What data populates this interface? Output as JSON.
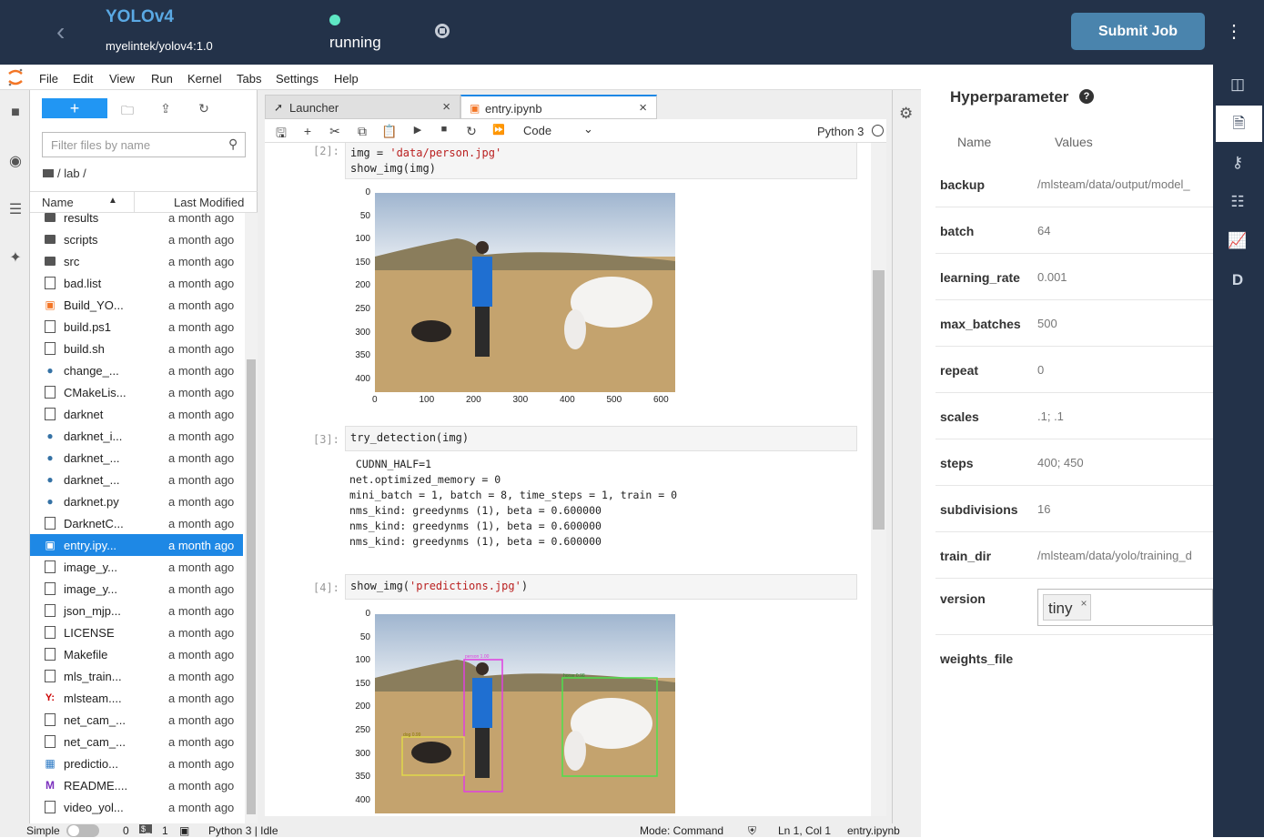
{
  "header": {
    "title": "YOLOv4",
    "image": "myelintek/yolov4:1.0",
    "status": "running",
    "submit_label": "Submit Job"
  },
  "menu": [
    "File",
    "Edit",
    "View",
    "Run",
    "Kernel",
    "Tabs",
    "Settings",
    "Help"
  ],
  "filebrowser": {
    "new_label": "+",
    "filter_placeholder": "Filter files by name",
    "breadcrumb": "/ lab /",
    "col_name": "Name",
    "col_modified": "Last Modified",
    "files": [
      {
        "name": "results",
        "type": "folder",
        "modified": "a month ago"
      },
      {
        "name": "scripts",
        "type": "folder",
        "modified": "a month ago"
      },
      {
        "name": "src",
        "type": "folder",
        "modified": "a month ago"
      },
      {
        "name": "bad.list",
        "type": "file",
        "modified": "a month ago"
      },
      {
        "name": "Build_YO...",
        "type": "notebook",
        "modified": "a month ago"
      },
      {
        "name": "build.ps1",
        "type": "file",
        "modified": "a month ago"
      },
      {
        "name": "build.sh",
        "type": "file",
        "modified": "a month ago"
      },
      {
        "name": "change_...",
        "type": "python",
        "modified": "a month ago"
      },
      {
        "name": "CMakeLis...",
        "type": "file",
        "modified": "a month ago"
      },
      {
        "name": "darknet",
        "type": "file",
        "modified": "a month ago"
      },
      {
        "name": "darknet_i...",
        "type": "python",
        "modified": "a month ago"
      },
      {
        "name": "darknet_...",
        "type": "python",
        "modified": "a month ago"
      },
      {
        "name": "darknet_...",
        "type": "python",
        "modified": "a month ago"
      },
      {
        "name": "darknet.py",
        "type": "python",
        "modified": "a month ago"
      },
      {
        "name": "DarknetC...",
        "type": "file",
        "modified": "a month ago"
      },
      {
        "name": "entry.ipy...",
        "type": "notebook",
        "modified": "a month ago",
        "selected": true
      },
      {
        "name": "image_y...",
        "type": "file",
        "modified": "a month ago"
      },
      {
        "name": "image_y...",
        "type": "file",
        "modified": "a month ago"
      },
      {
        "name": "json_mjp...",
        "type": "file",
        "modified": "a month ago"
      },
      {
        "name": "LICENSE",
        "type": "file",
        "modified": "a month ago"
      },
      {
        "name": "Makefile",
        "type": "file",
        "modified": "a month ago"
      },
      {
        "name": "mls_train...",
        "type": "file",
        "modified": "a month ago"
      },
      {
        "name": "mlsteam....",
        "type": "yaml",
        "modified": "a month ago"
      },
      {
        "name": "net_cam_...",
        "type": "file",
        "modified": "a month ago"
      },
      {
        "name": "net_cam_...",
        "type": "file",
        "modified": "a month ago"
      },
      {
        "name": "predictio...",
        "type": "image",
        "modified": "a month ago"
      },
      {
        "name": "README....",
        "type": "markdown",
        "modified": "a month ago"
      },
      {
        "name": "video_yol...",
        "type": "file",
        "modified": "a month ago"
      }
    ]
  },
  "tabs": [
    {
      "label": "Launcher"
    },
    {
      "label": "entry.ipynb"
    }
  ],
  "notebook": {
    "cell_type": "Code",
    "kernel": "Python 3",
    "cells": [
      {
        "prompt": "[2]:",
        "code_line1_a": "img = ",
        "code_line1_str": "'data/person.jpg'",
        "code_line2": "show_img(img)"
      },
      {
        "prompt": "[3]:",
        "code": "try_detection(img)",
        "output": " CUDNN_HALF=1\nnet.optimized_memory = 0\nmini_batch = 1, batch = 8, time_steps = 1, train = 0\nnms_kind: greedynms (1), beta = 0.600000\nnms_kind: greedynms (1), beta = 0.600000\nnms_kind: greedynms (1), beta = 0.600000"
      },
      {
        "prompt": "[4]:",
        "code_a": "show_img(",
        "code_str": "'predictions.jpg'",
        "code_b": ")"
      }
    ],
    "plot1": {
      "yticks": [
        "0",
        "50",
        "100",
        "150",
        "200",
        "250",
        "300",
        "350",
        "400"
      ],
      "xticks": [
        "0",
        "100",
        "200",
        "300",
        "400",
        "500",
        "600"
      ]
    },
    "plot2": {
      "yticks": [
        "0",
        "50",
        "100",
        "150",
        "200",
        "250",
        "300",
        "350",
        "400"
      ],
      "labels": [
        "person 1.00",
        "horse 0.98",
        "dog 0.99"
      ]
    }
  },
  "hyperparameter": {
    "title": "Hyperparameter",
    "col_name": "Names",
    "col_name_display": "Name",
    "col_values": "Values",
    "rows": [
      {
        "name": "backup",
        "value": "/mlsteam/data/output/model_"
      },
      {
        "name": "batch",
        "value": "64"
      },
      {
        "name": "learning_rate",
        "value": "0.001"
      },
      {
        "name": "max_batches",
        "value": "500"
      },
      {
        "name": "repeat",
        "value": "0"
      },
      {
        "name": "scales",
        "value": ".1; .1"
      },
      {
        "name": "steps",
        "value": "400; 450"
      },
      {
        "name": "subdivisions",
        "value": "16"
      },
      {
        "name": "train_dir",
        "value": "/mlsteam/data/yolo/training_d"
      }
    ],
    "version_label": "version",
    "version_tag": "tiny",
    "weights_label": "weights_file"
  },
  "statusbar": {
    "mode_label": "Simple",
    "terminals": "0",
    "kernels": "1",
    "kernel_status": "Python 3 | Idle",
    "command_mode": "Mode: Command",
    "cursor": "Ln 1, Col 1",
    "file": "entry.ipynb"
  }
}
